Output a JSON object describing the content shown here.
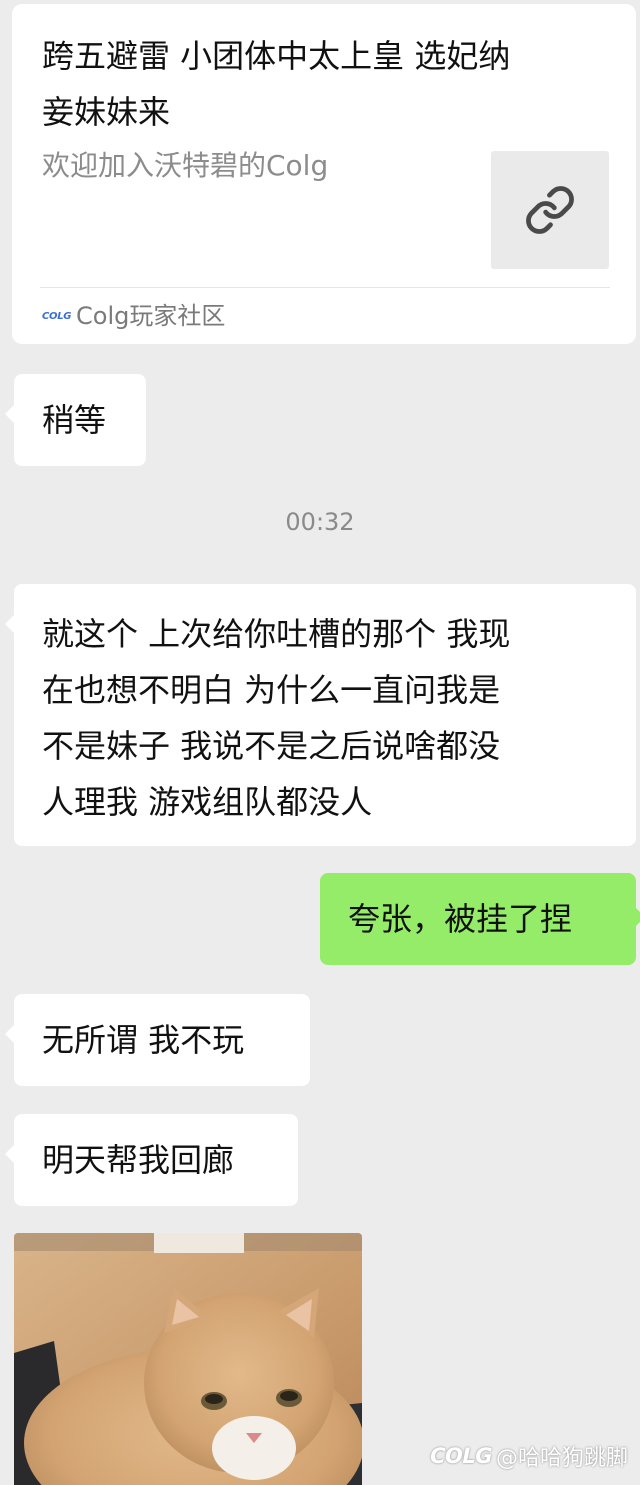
{
  "link_card": {
    "title_lines": [
      "跨五避雷 小团体中太上皇 选妃纳",
      "妾妹妹来"
    ],
    "description": "欢迎加入沃特碧的Colg",
    "thumbnail_icon": "link-icon",
    "source_logo": "COLG",
    "source_name": "Colg玩家社区"
  },
  "messages": [
    {
      "direction": "incoming",
      "lines": [
        "稍等"
      ]
    },
    {
      "direction": "incoming",
      "lines": [
        "就这个 上次给你吐槽的那个  我现",
        "在也想不明白 为什么一直问我是",
        "不是妹子 我说不是之后说啥都没",
        "人理我 游戏组队都没人"
      ]
    },
    {
      "direction": "outgoing",
      "lines": [
        "夸张，被挂了捏"
      ]
    },
    {
      "direction": "incoming",
      "lines": [
        "无所谓 我不玩"
      ]
    },
    {
      "direction": "incoming",
      "lines": [
        "明天帮我回廊"
      ]
    },
    {
      "direction": "incoming",
      "type": "image",
      "image_subject": "cat-sticker"
    }
  ],
  "timestamp": "00:32",
  "watermark": {
    "logo": "COLG",
    "handle": "@哈哈狗跳脚"
  },
  "colors": {
    "background": "#ececec",
    "incoming_bubble": "#ffffff",
    "outgoing_bubble": "#95ec69",
    "secondary_text": "#8c8c8c"
  }
}
